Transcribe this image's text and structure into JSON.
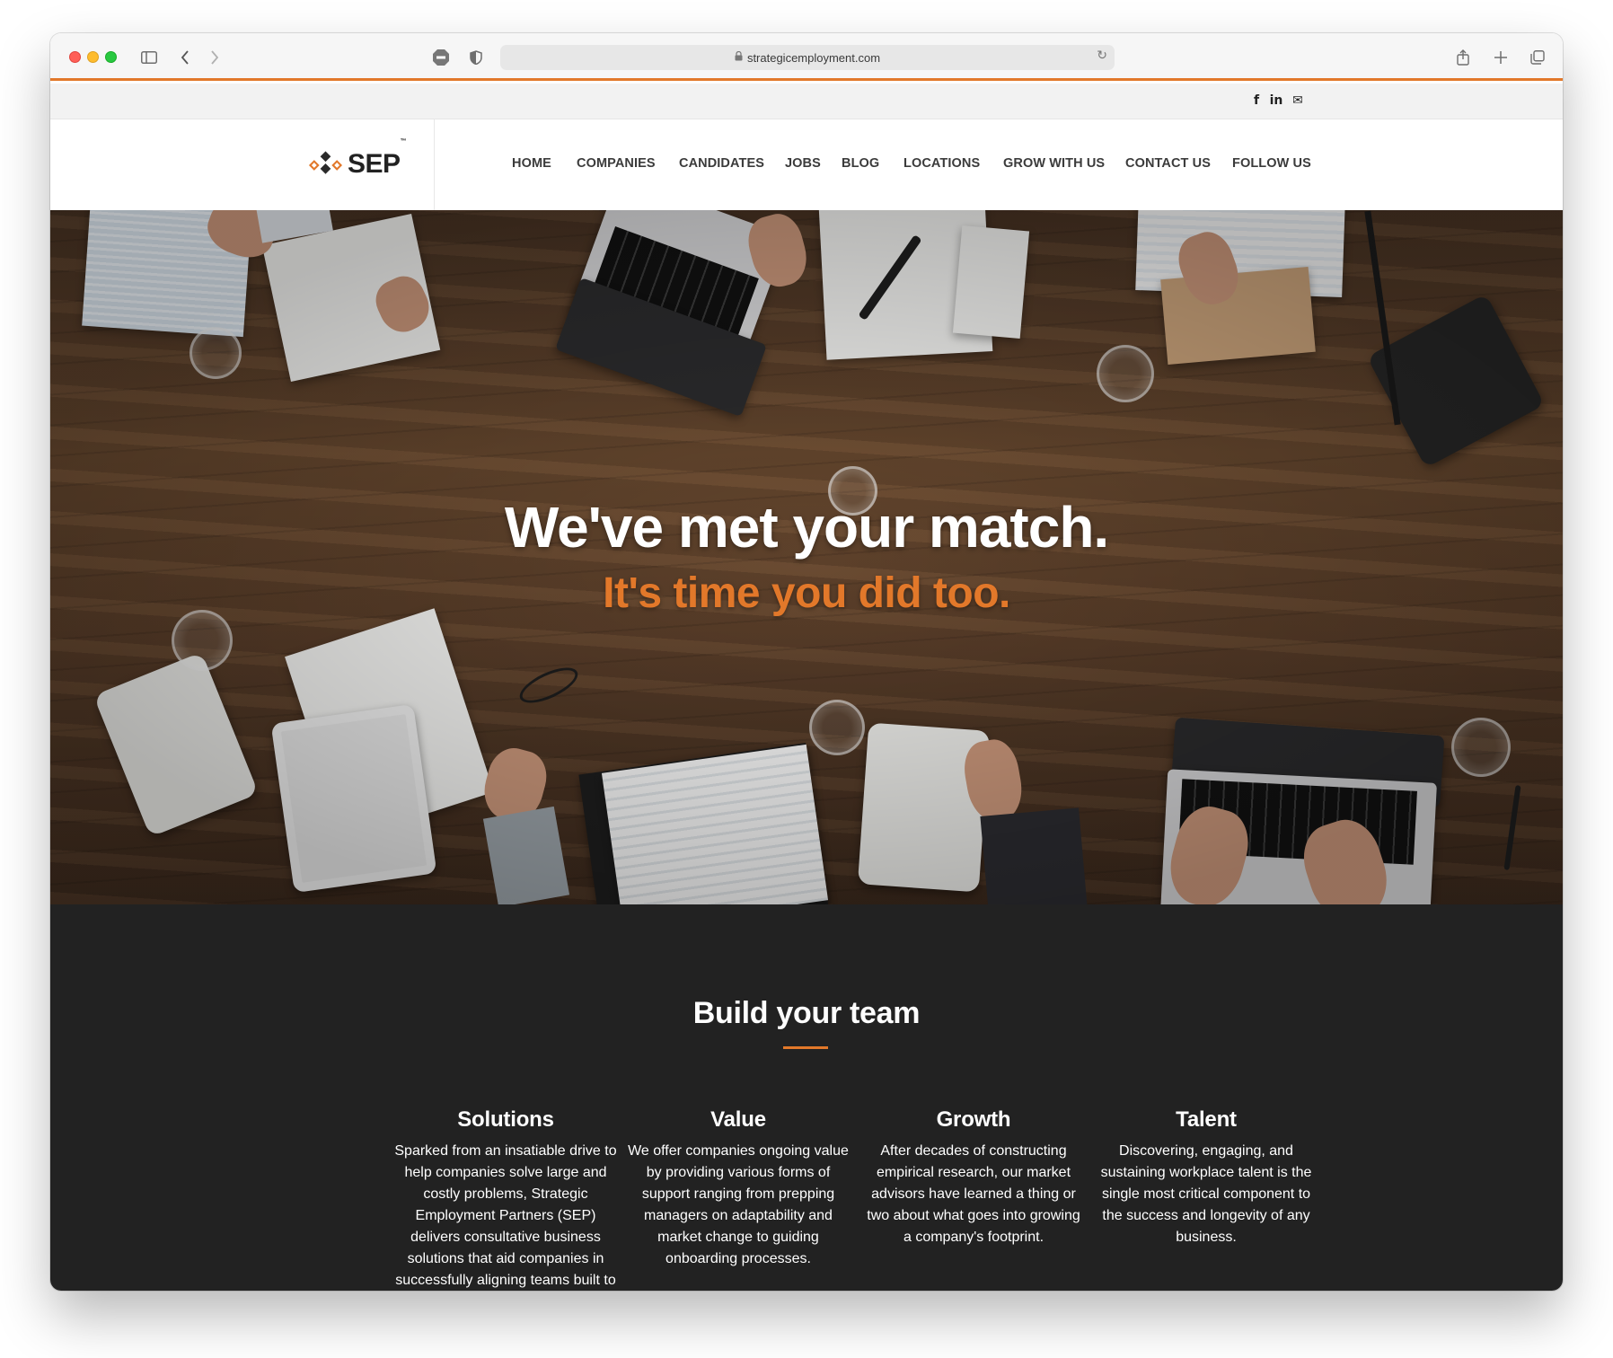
{
  "browser": {
    "url": "strategicemployment.com",
    "icons": [
      "sidebar-icon",
      "back-icon",
      "forward-icon",
      "adblock-icon",
      "privacy-shield-icon",
      "lock-icon",
      "reload-icon",
      "share-icon",
      "new-tab-icon",
      "tabs-overview-icon"
    ],
    "accent_color": "#e2782a"
  },
  "social": {
    "facebook": "f",
    "linkedin": "in",
    "email": "✉"
  },
  "header": {
    "logo_text": "SEP",
    "logo_tm": "™",
    "nav": [
      "HOME",
      "COMPANIES",
      "CANDIDATES",
      "JOBS",
      "BLOG",
      "LOCATIONS",
      "GROW WITH US",
      "CONTACT US",
      "FOLLOW US"
    ]
  },
  "hero": {
    "title": "We've met your match.",
    "subtitle": "It's time you did too."
  },
  "team": {
    "title": "Build your team",
    "features": [
      {
        "title": "Solutions",
        "text": "Sparked from an insatiable drive to help companies solve large and costly problems, Strategic Employment Partners (SEP) delivers consultative business solutions that aid companies in successfully aligning teams built to last."
      },
      {
        "title": "Value",
        "text": "We offer companies ongoing value by providing various forms of support ranging from prepping managers on adaptability and market change to guiding onboarding processes."
      },
      {
        "title": "Growth",
        "text": "After decades of constructing empirical research, our market advisors have learned a thing or two about what goes into growing a company's footprint."
      },
      {
        "title": "Talent",
        "text": "Discovering, engaging, and sustaining workplace talent is the single most critical component to the success and longevity of any business."
      }
    ]
  },
  "colors": {
    "brand_orange": "#e2782a",
    "dark_section": "#222222",
    "nav_text": "#3b3b3b"
  }
}
